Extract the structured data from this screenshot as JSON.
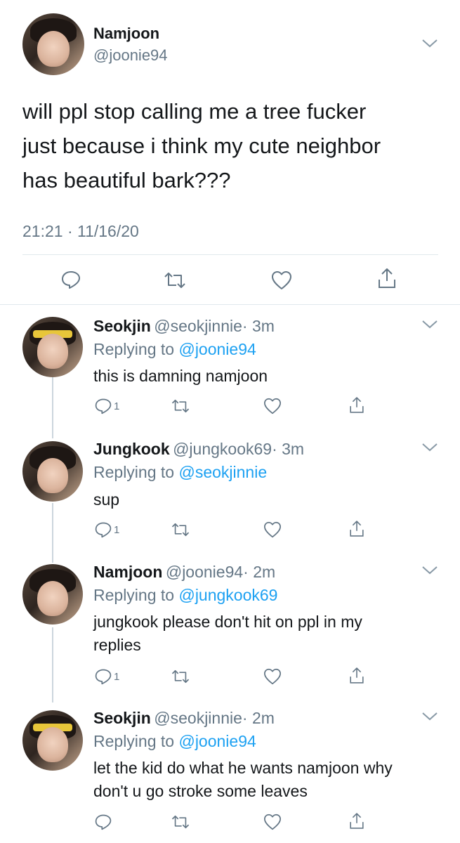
{
  "main_tweet": {
    "name": "Namjoon",
    "handle": "@joonie94",
    "text_lines": [
      "will ppl stop calling me a tree fucker",
      "just because i think my cute neighbor",
      "has beautiful bark???"
    ],
    "timestamp": "21:21 · 11/16/20"
  },
  "replies": [
    {
      "name": "Seokjin",
      "handle": "@seokjinnie",
      "time": "· 3m",
      "replying_prefix": "Replying to ",
      "replying_to": "@joonie94",
      "lines": [
        "this is damning namjoon"
      ],
      "reply_count": "1"
    },
    {
      "name": "Jungkook",
      "handle": "@jungkook69",
      "time": "· 3m",
      "replying_prefix": "Replying to ",
      "replying_to": "@seokjinnie",
      "lines": [
        "sup"
      ],
      "reply_count": "1"
    },
    {
      "name": "Namjoon",
      "handle": "@joonie94",
      "time": "· 2m",
      "replying_prefix": "Replying to ",
      "replying_to": "@jungkook69",
      "lines": [
        "jungkook please don't hit on ppl in my",
        "replies"
      ],
      "reply_count": "1"
    },
    {
      "name": "Seokjin",
      "handle": "@seokjinnie",
      "time": "· 2m",
      "replying_prefix": "Replying to ",
      "replying_to": "@joonie94",
      "lines": [
        "let the kid do what he wants namjoon why",
        "don't u go stroke some leaves"
      ],
      "reply_count": ""
    }
  ],
  "colors": {
    "link": "#1da1f2",
    "secondary_text": "#657786",
    "divider": "#e1e8ed",
    "thread_line": "#ccd6dd"
  },
  "icons": [
    "chevron-down-icon",
    "reply-icon",
    "retweet-icon",
    "like-icon",
    "share-icon"
  ]
}
